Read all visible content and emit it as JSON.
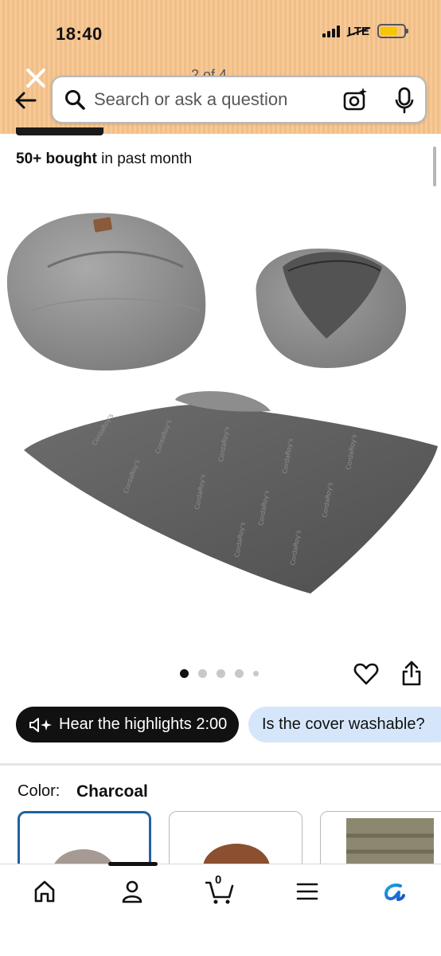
{
  "status_bar": {
    "time": "18:40",
    "network": "LTE",
    "battery_percent": 0.75
  },
  "header": {
    "page_indicator": "2 of 4",
    "search_placeholder": "Search or ask a question"
  },
  "product": {
    "bought_bold": "50+ bought",
    "bought_rest": " in past month"
  },
  "gallery": {
    "image_count": 5,
    "active_index": 0
  },
  "actions": {
    "hear_label": "Hear the highlights 2:00",
    "question_chip": "Is the cover washable?"
  },
  "variation": {
    "color_label": "Color:",
    "color_value": "Charcoal"
  },
  "bottom_nav": {
    "cart_count": "0",
    "items": [
      "home",
      "account",
      "cart",
      "menu",
      "rufus"
    ]
  },
  "colors": {
    "header_bg": "#f6c996",
    "accent_blue": "#2162a1",
    "chip_blue": "#d6e6fa",
    "battery": "#f7c600"
  }
}
